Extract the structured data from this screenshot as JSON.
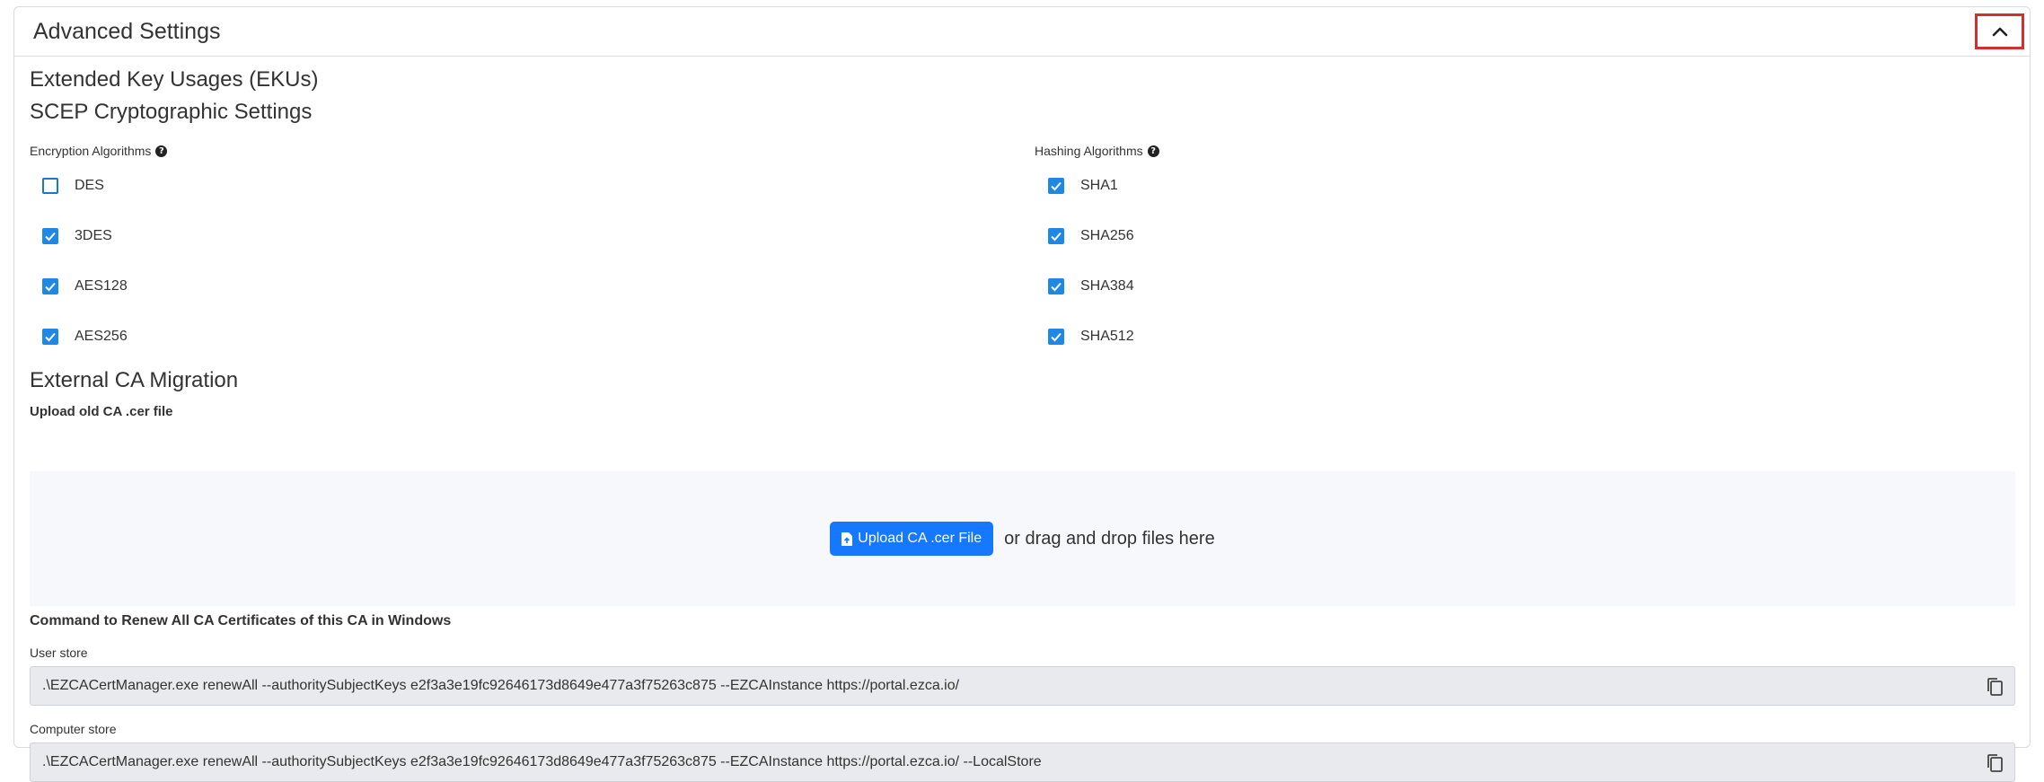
{
  "panel": {
    "title": "Advanced Settings"
  },
  "sections": {
    "eku_title": "Extended Key Usages (EKUs)",
    "scep_title": "SCEP Cryptographic Settings",
    "migration_title": "External CA Migration"
  },
  "encryption": {
    "label": "Encryption Algorithms",
    "items": [
      {
        "label": "DES",
        "checked": false
      },
      {
        "label": "3DES",
        "checked": true
      },
      {
        "label": "AES128",
        "checked": true
      },
      {
        "label": "AES256",
        "checked": true
      }
    ]
  },
  "hashing": {
    "label": "Hashing Algorithms",
    "items": [
      {
        "label": "SHA1",
        "checked": true
      },
      {
        "label": "SHA256",
        "checked": true
      },
      {
        "label": "SHA384",
        "checked": true
      },
      {
        "label": "SHA512",
        "checked": true
      }
    ]
  },
  "upload": {
    "label": "Upload old CA .cer file",
    "button": "Upload CA .cer File",
    "drop_text": "or drag and drop files here"
  },
  "renew": {
    "title": "Command to Renew All CA Certificates of this CA in Windows",
    "user_label": "User store",
    "user_cmd": ".\\EZCACertManager.exe renewAll --authoritySubjectKeys e2f3a3e19fc92646173d8649e477a3f75263c875 --EZCAInstance https://portal.ezca.io/",
    "computer_label": "Computer store",
    "computer_cmd": ".\\EZCACertManager.exe renewAll --authoritySubjectKeys e2f3a3e19fc92646173d8649e477a3f75263c875 --EZCAInstance https://portal.ezca.io/ --LocalStore"
  },
  "colors": {
    "accent": "#1677ff",
    "checkbox": "#1e88e5",
    "highlight_border": "#d32f2f"
  }
}
